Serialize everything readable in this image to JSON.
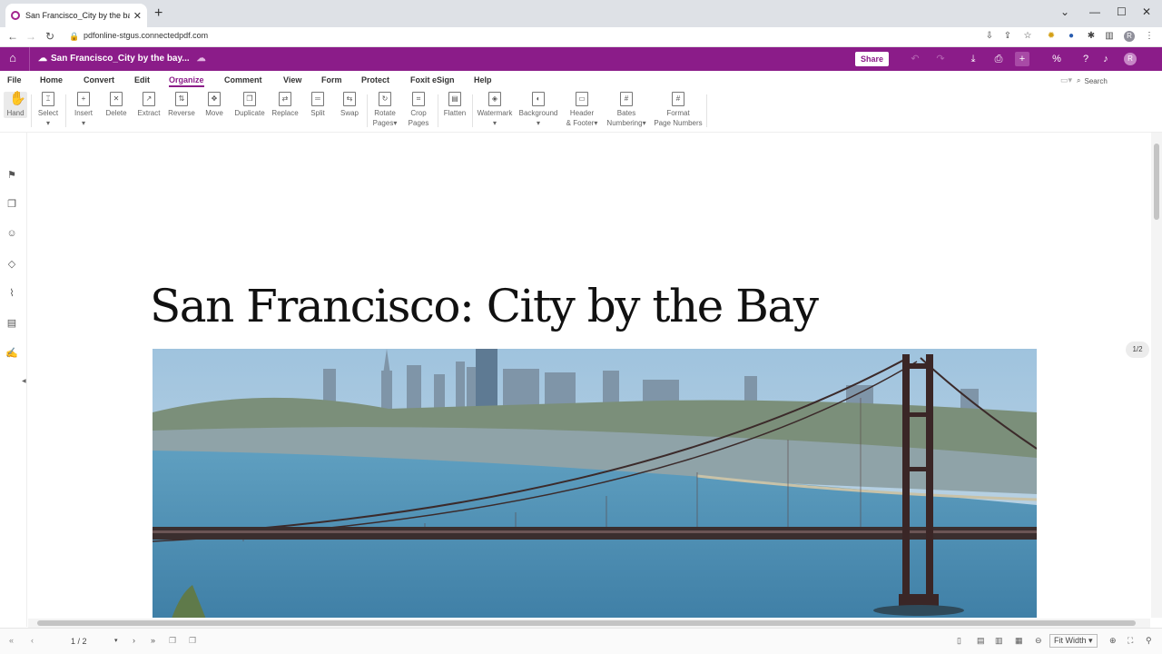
{
  "browser": {
    "tab_title": "San Francisco_City by the bay.pdf",
    "url": "pdfonline-stgus.connectedpdf.com",
    "avatar_letter": "R"
  },
  "app": {
    "doc_title": "San Francisco_City by the bay...",
    "share_label": "Share",
    "avatar_letter": "R",
    "brand_color": "#8b1c89"
  },
  "menu": {
    "items": [
      "File",
      "Home",
      "Convert",
      "Edit",
      "Organize",
      "Comment",
      "View",
      "Form",
      "Protect",
      "Foxit eSign",
      "Help"
    ],
    "active": "Organize",
    "search_placeholder": "Search"
  },
  "toolbar": {
    "hand": "Hand",
    "select": "Select",
    "insert": "Insert",
    "delete": "Delete",
    "extract": "Extract",
    "reverse": "Reverse",
    "move": "Move",
    "duplicate": "Duplicate",
    "replace": "Replace",
    "split": "Split",
    "swap": "Swap",
    "rotate_l1": "Rotate",
    "rotate_l2": "Pages",
    "crop_l1": "Crop",
    "crop_l2": "Pages",
    "flatten": "Flatten",
    "watermark": "Watermark",
    "background": "Background",
    "header_l1": "Header",
    "header_l2": "& Footer",
    "bates_l1": "Bates",
    "bates_l2": "Numbering",
    "format_l1": "Format",
    "format_l2": "Page Numbers"
  },
  "document": {
    "title": "San Francisco: City by the Bay",
    "page_indicator": "1/2"
  },
  "status": {
    "page_field": "1 / 2",
    "zoom": "Fit Width"
  }
}
